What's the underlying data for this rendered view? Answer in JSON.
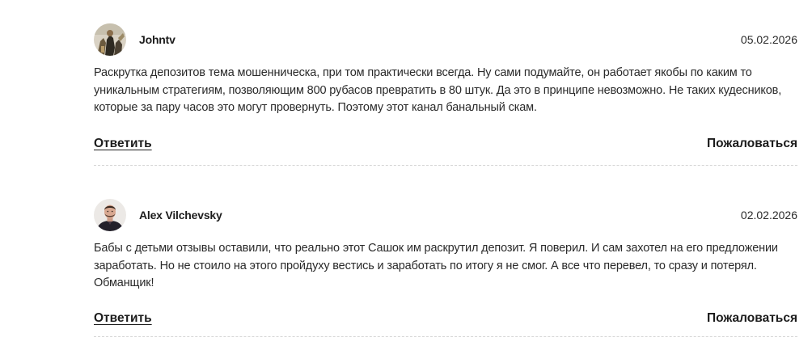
{
  "comments": [
    {
      "author": "Johntv",
      "date": "05.02.2026",
      "avatar_icon": "user-photo-icon",
      "text_lines": [
        "Раскрутка депозитов тема мошенническа, при том практически всегда. Ну сами подумайте, он работает якобы по каким то",
        "уникальным стратегиям, позволяющим 800 рубасов превратить в 80 штук. Да это в принципе невозможно. Не таких кудесников,",
        "которые за пару часов это могут провернуть. Поэтому этот канал банальный скам."
      ],
      "reply_label": "Ответить",
      "report_label": "Пожаловаться"
    },
    {
      "author": "Alex Vilchevsky",
      "date": "02.02.2026",
      "avatar_icon": "user-photo-icon",
      "text_lines": [
        "Бабы с детьми отзывы оставили, что реально этот Сашок им раскрутил депозит. Я поверил. И сам захотел на его предложении",
        "заработать. Но не стоило на этого пройдуху вестись и заработать по итогу я не смог. А все что перевел, то сразу и потерял.",
        "Обманщик!"
      ],
      "reply_label": "Ответить",
      "report_label": "Пожаловаться"
    }
  ]
}
